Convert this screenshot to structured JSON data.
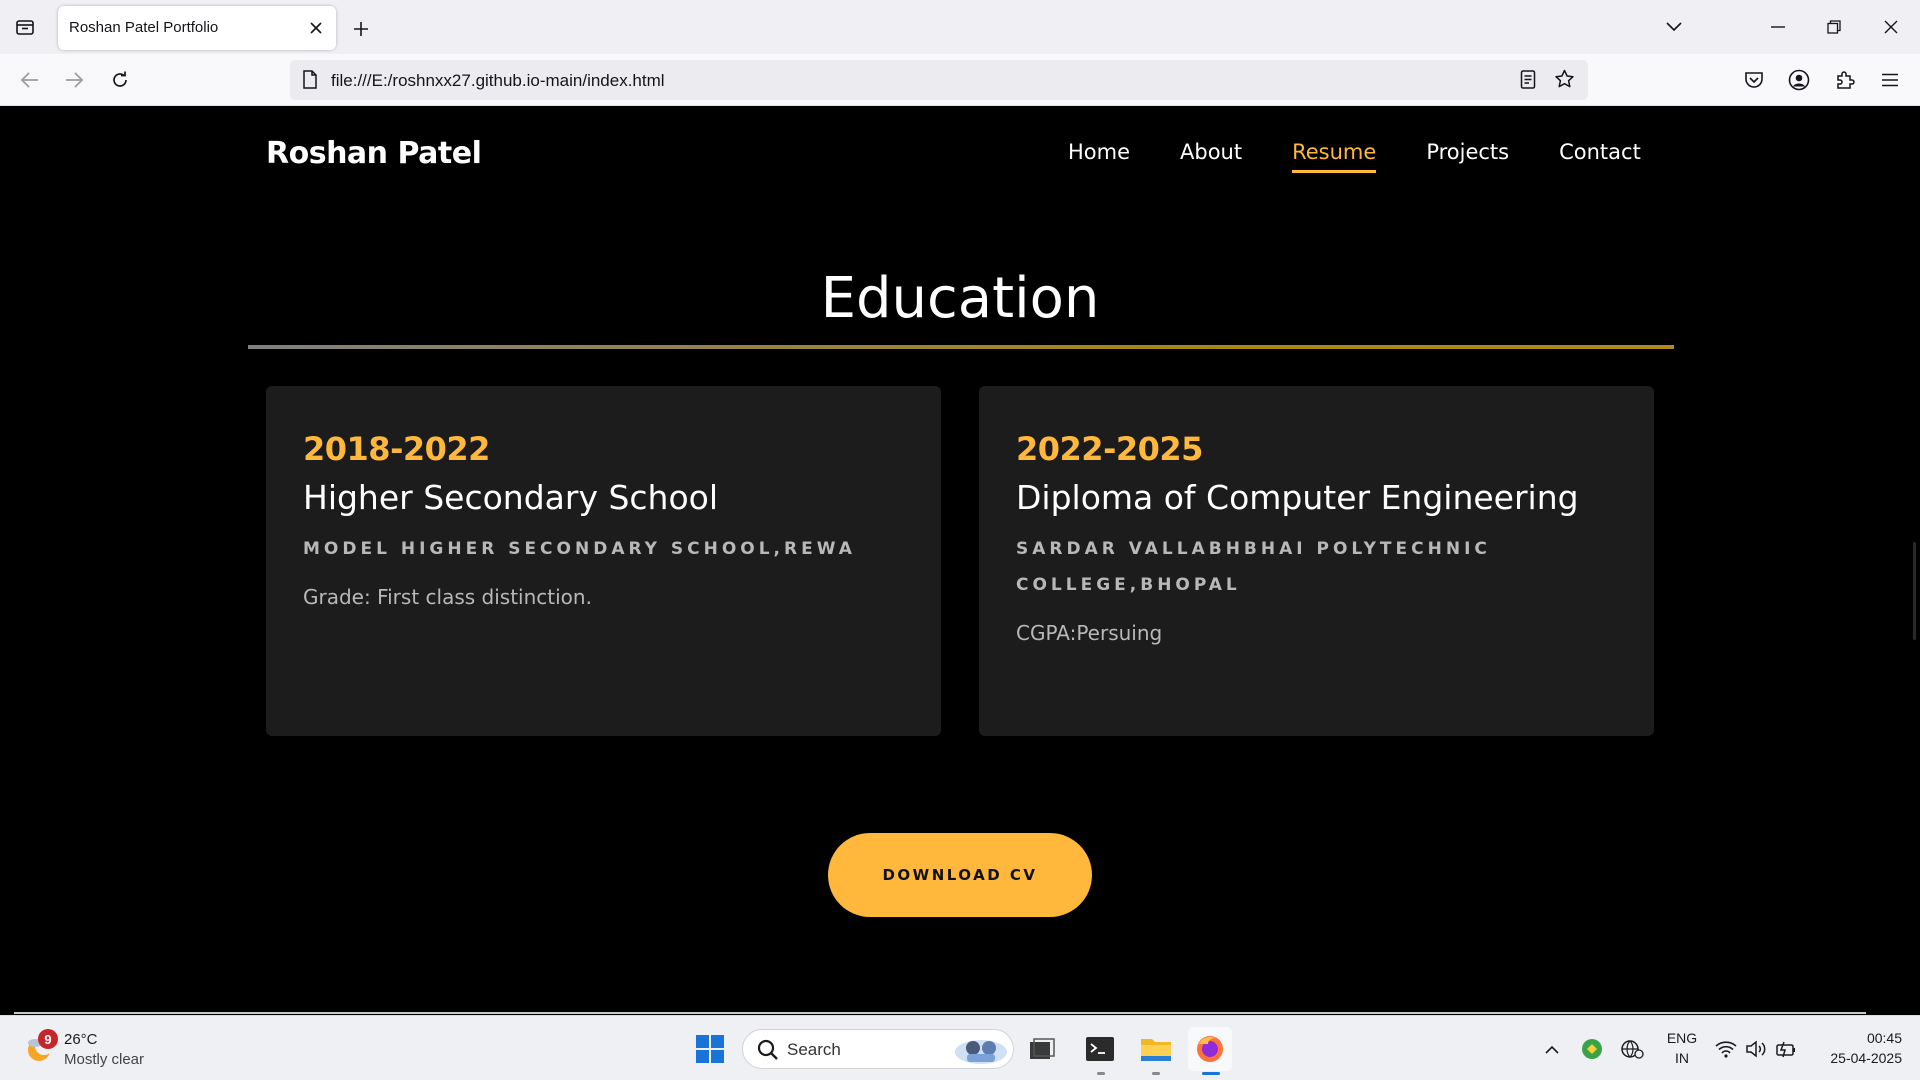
{
  "browser": {
    "tab_title": "Roshan Patel Portfolio",
    "url": "file:///E:/roshnxx27.github.io-main/index.html"
  },
  "site": {
    "brand": "Roshan Patel",
    "nav": [
      {
        "label": "Home",
        "active": false
      },
      {
        "label": "About",
        "active": false
      },
      {
        "label": "Resume",
        "active": true
      },
      {
        "label": "Projects",
        "active": false
      },
      {
        "label": "Contact",
        "active": false
      }
    ],
    "accent_color": "#ffb83b"
  },
  "education": {
    "title": "Education",
    "cards": [
      {
        "years": "2018-2022",
        "title": "Higher Secondary School",
        "institution": "MODEL HIGHER SECONDARY SCHOOL,REWA",
        "grade": "Grade: First class distinction."
      },
      {
        "years": "2022-2025",
        "title": "Diploma of Computer Engineering",
        "institution": "SARDAR VALLABHBHAI POLYTECHNIC COLLEGE,BHOPAL",
        "grade": "CGPA:Persuing"
      }
    ],
    "download_label": "DOWNLOAD CV"
  },
  "taskbar": {
    "weather_temp": "26°C",
    "weather_desc": "Mostly clear",
    "weather_badge": "9",
    "search_placeholder": "Search",
    "lang_top": "ENG",
    "lang_bottom": "IN",
    "time": "00:45",
    "date": "25-04-2025"
  }
}
